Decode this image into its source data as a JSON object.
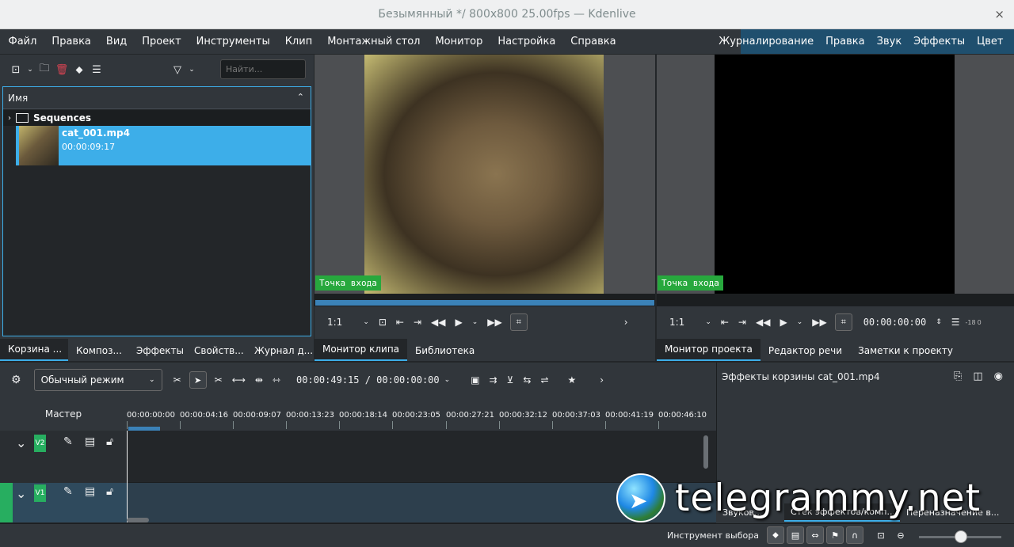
{
  "window": {
    "title": "Безымянный */ 800x800 25.00fps — Kdenlive",
    "close": "×"
  },
  "menu": [
    "Файл",
    "Правка",
    "Вид",
    "Проект",
    "Инструменты",
    "Клип",
    "Монтажный стол",
    "Монитор",
    "Настройка",
    "Справка"
  ],
  "layouts": [
    "Журналирование",
    "Правка",
    "Звук",
    "Эффекты",
    "Цвет"
  ],
  "bin": {
    "search_placeholder": "Найти...",
    "column_header": "Имя",
    "folder": "Sequences",
    "clip_name": "cat_001.mp4",
    "clip_duration": "00:00:09:17"
  },
  "left_tabs": [
    "Корзина ...",
    "Композ...",
    "Эффекты",
    "Свойств...",
    "Журнал д..."
  ],
  "clip_monitor": {
    "inpoint_label": "Точка  входа",
    "zoom": "1:1",
    "tabs": [
      "Монитор клипа",
      "Библиотека"
    ]
  },
  "project_monitor": {
    "inpoint_label": "Точка  входа",
    "zoom": "1:1",
    "timecode": "00:00:00:00",
    "audio_db": "-18",
    "audio_zero": "0",
    "tabs": [
      "Монитор проекта",
      "Редактор речи",
      "Заметки к проекту"
    ]
  },
  "timeline_toolbar": {
    "mode": "Обычный режим",
    "timecode": "00:00:49:15 / 00:00:00:00"
  },
  "timeline": {
    "master_label": "Мастер",
    "ticks": [
      "00:00:00:00",
      "00:00:04:16",
      "00:00:09:07",
      "00:00:13:23",
      "00:00:18:14",
      "00:00:23:05",
      "00:00:27:21",
      "00:00:32:12",
      "00:00:37:03",
      "00:00:41:19",
      "00:00:46:10"
    ],
    "tracks": [
      {
        "name": "V2"
      },
      {
        "name": "V1"
      }
    ]
  },
  "effects_panel": {
    "title": "Эффекты корзины cat_001.mp4",
    "tabs": [
      "Звуков...",
      "Стек эффектов/комп...",
      "Переназначение в..."
    ]
  },
  "status": {
    "tool": "Инструмент выбора"
  },
  "watermark": {
    "text": "telegrammy.net"
  },
  "colors": {
    "accent": "#3daee9",
    "inpoint": "#27a83d",
    "track_tag": "#27ae60",
    "layout_bar": "#1f4f6e"
  }
}
